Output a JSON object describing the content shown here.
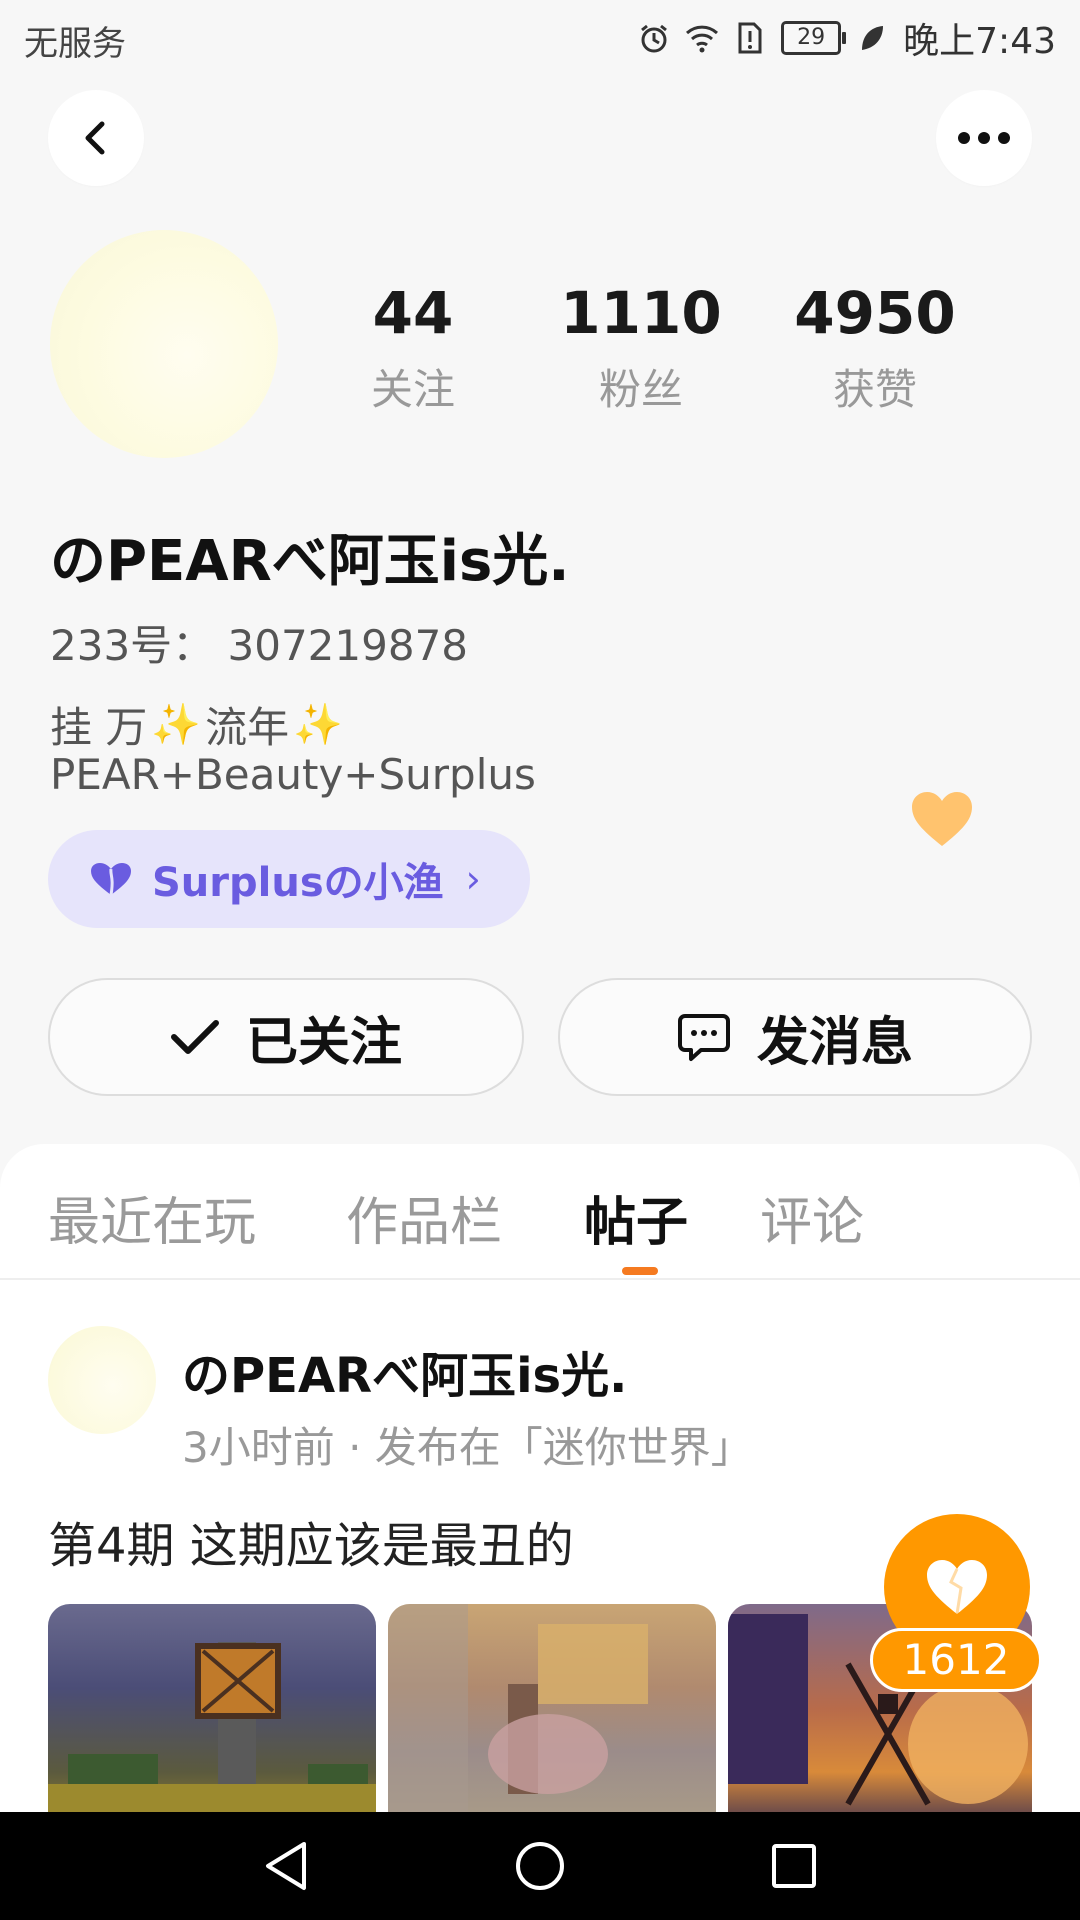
{
  "status_bar": {
    "carrier": "无服务",
    "battery": "29",
    "time": "晚上7:43",
    "icons": [
      "alarm-icon",
      "wifi-icon",
      "sim-alert-icon",
      "battery-icon",
      "leaf-icon"
    ]
  },
  "header": {
    "back_icon": "chevron-left-icon",
    "more_icon": "more-dots-icon"
  },
  "profile": {
    "stats": [
      {
        "value": "44",
        "label": "关注"
      },
      {
        "value": "1110",
        "label": "粉丝"
      },
      {
        "value": "4950",
        "label": "获赞"
      }
    ],
    "username": "のPEARべ阿玉is光.",
    "uid_text": "233号：  307219878",
    "bio_line1_a": "挂 万",
    "bio_line1_b": "流年",
    "bio_sparkle": "✨",
    "bio_line2": "PEAR+Beauty+Surplus",
    "group_chip": "Surplusの小渔",
    "group_chevron": "›"
  },
  "actions": {
    "follow_label": "已关注",
    "message_label": "发消息"
  },
  "tabs": [
    {
      "label": "最近在玩",
      "active": false
    },
    {
      "label": "作品栏",
      "active": false
    },
    {
      "label": "帖子",
      "active": true
    },
    {
      "label": "评论",
      "active": false
    }
  ],
  "post": {
    "author": "のPEARべ阿玉is光.",
    "meta": "3小时前 · 发布在「迷你世界」",
    "title": "第4期 这期应该是最丑的",
    "like_count": "1612"
  },
  "colors": {
    "accent": "#ff9800",
    "tab_indicator": "#f57a20",
    "chip_bg": "#e6e4fb",
    "chip_text": "#6a5ce0",
    "heart": "#ffc36e"
  }
}
